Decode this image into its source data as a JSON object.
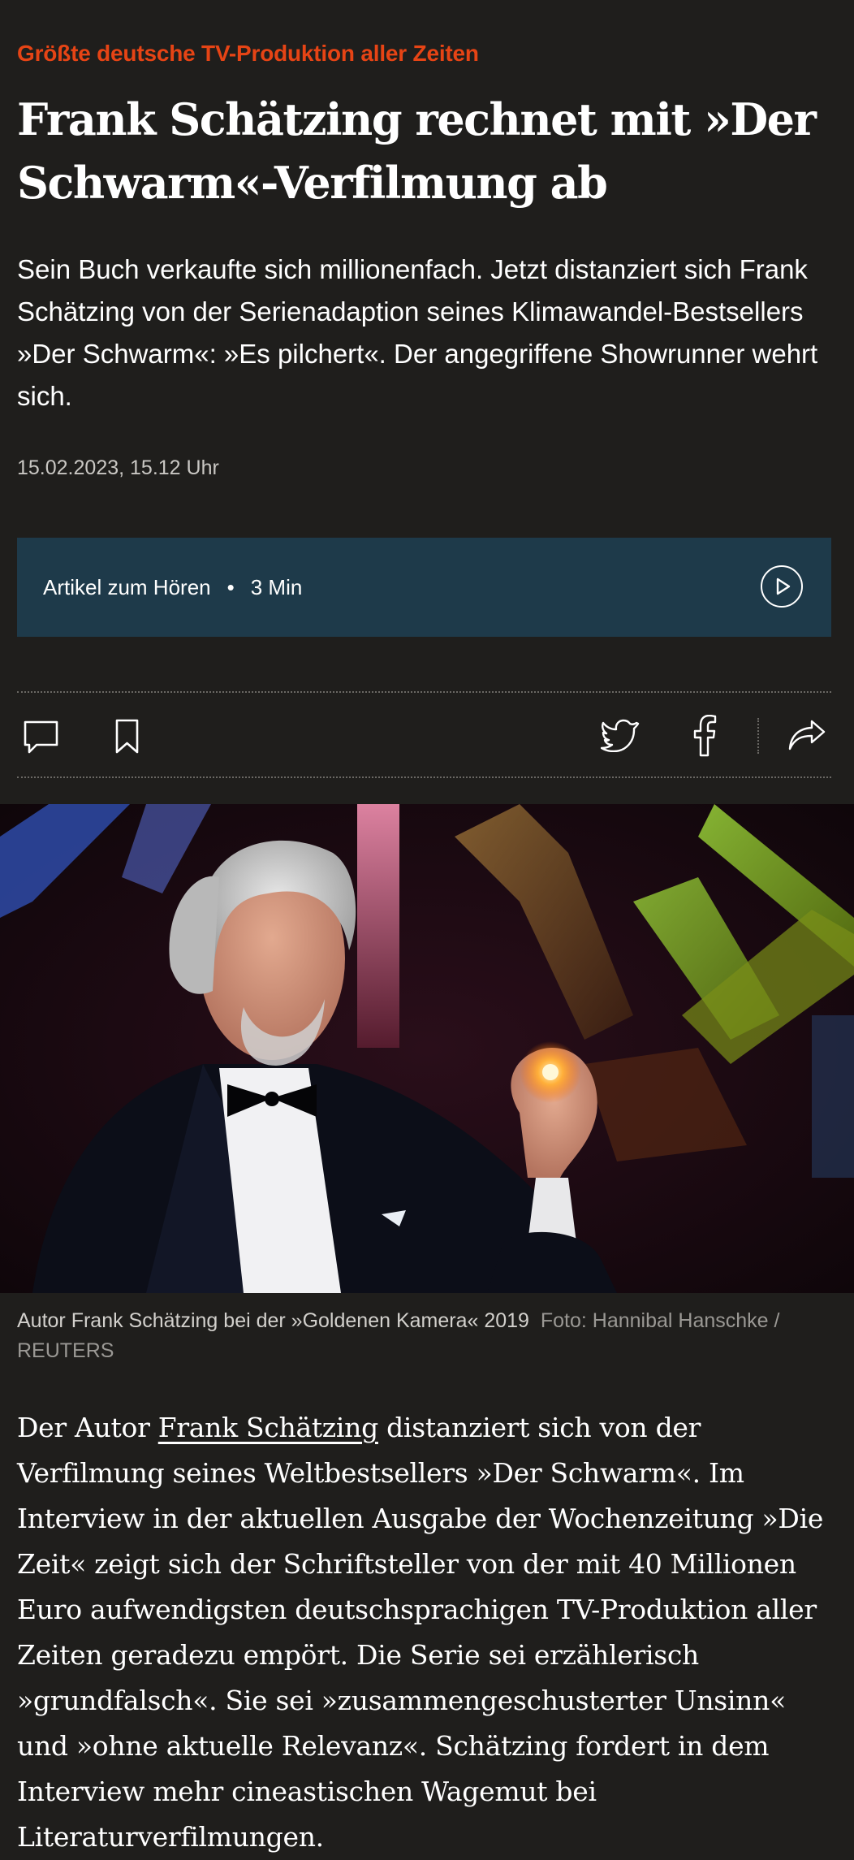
{
  "article": {
    "kicker": "Größte deutsche TV-Produktion aller Zeiten",
    "headline": "Frank Schätzing rechnet mit »Der Schwarm«-Verfilmung ab",
    "lead": "Sein Buch verkaufte sich millionenfach. Jetzt distanziert sich Frank Schätzing von der Serienadaption seines Klimawandel-Bestsellers »Der Schwarm«: »Es pilchert«. Der angegriffene Showrunner wehrt sich.",
    "date": "15.02.2023, 15.12 Uhr"
  },
  "audio": {
    "label": "Artikel zum Hören",
    "separator": "•",
    "duration": "3 Min",
    "icon": "play-icon"
  },
  "toolbar": {
    "icons": [
      "comment-icon",
      "bookmark-icon",
      "twitter-icon",
      "facebook-icon",
      "share-icon"
    ]
  },
  "image": {
    "caption": "Autor Frank Schätzing bei der »Goldenen Kamera« 2019",
    "credit": "Foto: Hannibal Hanschke / REUTERS"
  },
  "body": {
    "before_link": "Der Autor ",
    "link_text": "Frank Schätzing",
    "after_link": " distanziert sich von der Verfilmung seines Weltbestsellers »Der Schwarm«. Im Interview in der aktuellen Ausgabe der Wochenzeitung »Die Zeit« zeigt sich der Schriftsteller von der mit 40 Millionen Euro aufwendigsten deutschsprachigen TV-Produktion aller Zeiten geradezu empört. Die Serie sei erzählerisch »grundfalsch«. Sie sei »zusammengeschusterter Unsinn« und »ohne aktuelle Relevanz«. Schätzing fordert in dem Interview mehr cineastischen Wagemut bei Literaturverfilmungen."
  },
  "colors": {
    "background": "#1f1e1c",
    "kicker": "#e64415",
    "audio_bar": "#1e3a4a"
  }
}
